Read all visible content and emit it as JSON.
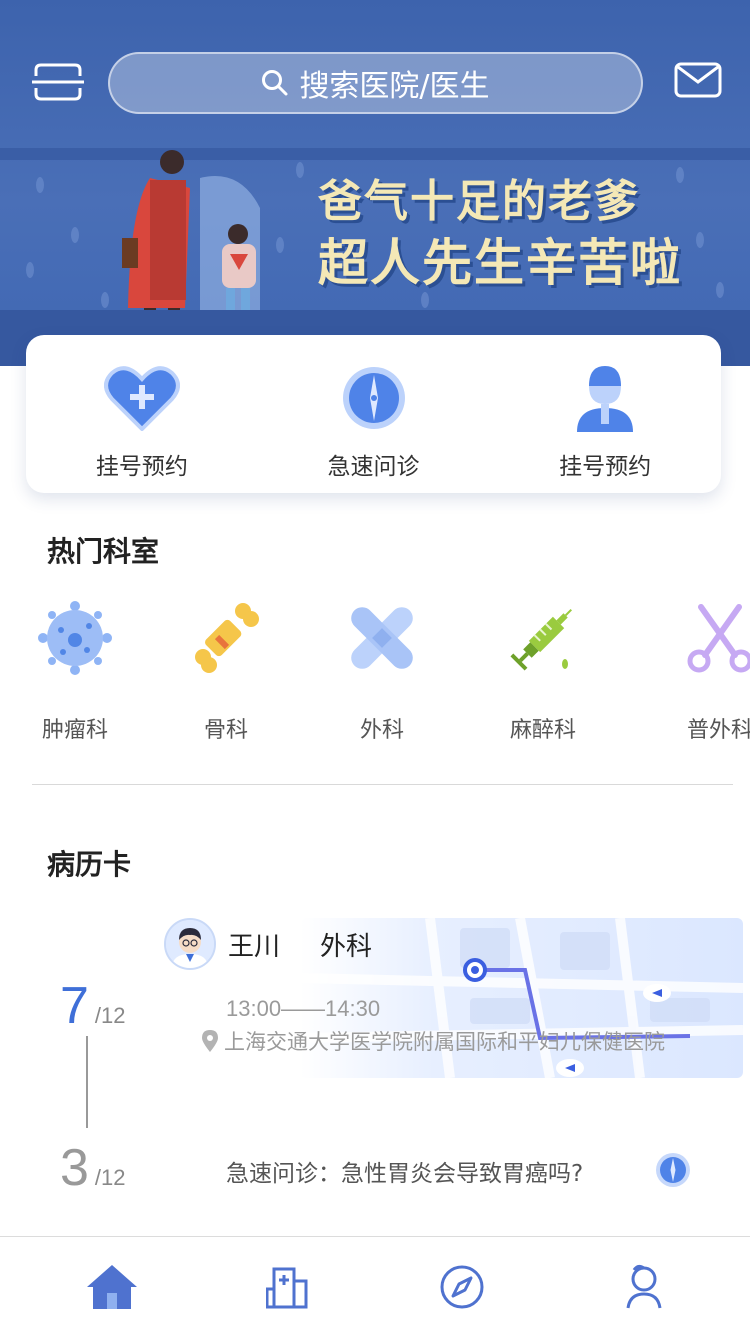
{
  "header": {
    "search_placeholder": "搜索医院/医生",
    "scan_icon": "scan-icon",
    "mail_icon": "mail-icon"
  },
  "banner": {
    "line1": "爸气十足的老爹",
    "line2": "超人先生辛苦啦"
  },
  "quick_actions": [
    {
      "label": "挂号预约",
      "icon": "heart-plus-icon"
    },
    {
      "label": "急速问诊",
      "icon": "compass-icon"
    },
    {
      "label": "挂号预约",
      "icon": "doctor-icon"
    }
  ],
  "departments": {
    "title": "热门科室",
    "items": [
      {
        "label": "肿瘤科",
        "icon": "virus-icon"
      },
      {
        "label": "骨科",
        "icon": "bone-icon"
      },
      {
        "label": "外科",
        "icon": "bandage-icon"
      },
      {
        "label": "麻醉科",
        "icon": "syringe-icon"
      },
      {
        "label": "普外科",
        "icon": "scissors-icon"
      }
    ]
  },
  "records": {
    "title": "病历卡",
    "items": [
      {
        "day": "7",
        "month": "/12",
        "doctor": "王川",
        "dept": "外科",
        "time": "13:00——14:30",
        "location": "上海交通大学医学院附属国际和平妇儿保健医院"
      },
      {
        "day": "3",
        "month": "/12",
        "text": "急速问诊：急性胃炎会导致胃癌吗?"
      }
    ]
  },
  "tabs": [
    {
      "name": "home",
      "icon": "home-icon"
    },
    {
      "name": "hospital",
      "icon": "hospital-icon"
    },
    {
      "name": "discover",
      "icon": "compass-icon"
    },
    {
      "name": "profile",
      "icon": "user-icon"
    }
  ],
  "colors": {
    "primary": "#3f6fd8",
    "header_bg": "#4a6fb7",
    "banner_text": "#f4e8b6"
  }
}
